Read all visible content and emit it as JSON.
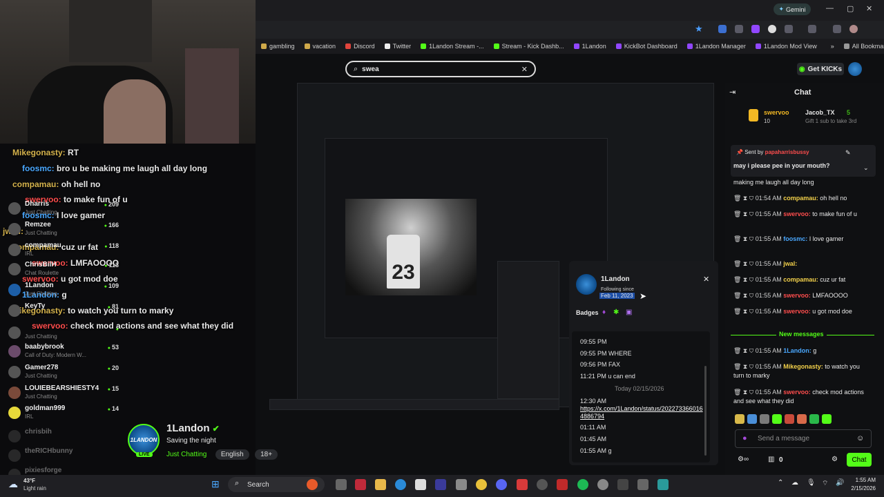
{
  "browser": {
    "gemini_label": "Gemini",
    "bookmarks": [
      "gambling",
      "vacation",
      "Discord",
      "Twitter",
      "1Landon Stream -...",
      "Stream - Kick Dashb...",
      "1Landon",
      "KickBot Dashboard",
      "1Landon Manager",
      "1Landon Mod View"
    ],
    "all_bookmarks": "All Bookmarks"
  },
  "search": {
    "value": "swea"
  },
  "header": {
    "get_kicks": "Get KICKs"
  },
  "stream_overlay": {
    "messages": [
      {
        "user": "Mikegonasty:",
        "text": "RT"
      },
      {
        "user": "foosmc:",
        "text": "bro u be making me laugh all day long"
      },
      {
        "user": "compamau:",
        "text": "oh hell no"
      },
      {
        "user": "swervoo:",
        "text": "to make fun of u"
      },
      {
        "user": "foosmc:",
        "text": "I love gamer"
      },
      {
        "user": "compamau:",
        "text": "cuz ur fat"
      },
      {
        "user": "jwall:",
        "text": ""
      },
      {
        "user": "swervoo:",
        "text": "LMFAOOOO"
      },
      {
        "user": "swervoo:",
        "text": "u got mod doe"
      },
      {
        "user": "1Landon:",
        "text": "g"
      },
      {
        "user": "Mikegonasty:",
        "text": "to watch you turn to marky"
      },
      {
        "user": "swervoo:",
        "text": "check mod actions and see what they did"
      }
    ],
    "viewers": [
      {
        "name": "Dharris",
        "cat": "Just Chatting",
        "count": "209"
      },
      {
        "name": "Remzee",
        "cat": "Just Chatting",
        "count": "166"
      },
      {
        "name": "compamau",
        "cat": "IRL",
        "count": "118"
      },
      {
        "name": "ChrisBilH",
        "cat": "Chat Roulette",
        "count": "113"
      },
      {
        "name": "1Landon",
        "cat": "Just Chatting",
        "count": "109"
      },
      {
        "name": "KeyTy",
        "cat": "",
        "count": "81"
      },
      {
        "name": "",
        "cat": "Just Chatting",
        "count": ""
      },
      {
        "name": "baabybrook",
        "cat": "Call of Duty: Modern W...",
        "count": "53"
      },
      {
        "name": "Gamer278",
        "cat": "Just Chatting",
        "count": "20"
      },
      {
        "name": "LOUIEBEARSHIESTY4",
        "cat": "Just Chatting",
        "count": "15"
      },
      {
        "name": "goldman999",
        "cat": "IRL",
        "count": "14"
      },
      {
        "name": "chrisbih",
        "cat": "",
        "count": ""
      },
      {
        "name": "theRICHbunny",
        "cat": "",
        "count": ""
      },
      {
        "name": "pixiesforge",
        "cat": "",
        "count": ""
      }
    ]
  },
  "stream_info": {
    "avatar_text": "1LANDON",
    "live": "LIVE",
    "name": "1Landon",
    "title": "Saving the night",
    "category": "Just Chatting",
    "language": "English",
    "age": "18+"
  },
  "chat": {
    "title": "Chat",
    "top_gifter": {
      "rank_user": "swervoo",
      "rank_count": "10",
      "second_user": "Jacob_TX",
      "second_count": "5",
      "note": "Gift 1 sub to take 3rd"
    },
    "pinned": {
      "sent_by": "Sent by",
      "sender": "papaharrisbussy",
      "text": "may i please pee in your mouth?"
    },
    "prev_text": "making me laugh all day long",
    "messages": [
      {
        "time": "01:54 AM",
        "user": "compamau:",
        "text": "oh hell no"
      },
      {
        "time": "01:55 AM",
        "user": "swervoo:",
        "text": "to make fun of u"
      },
      {
        "time": "01:55 AM",
        "user": "foosmc:",
        "text": "I love gamer"
      },
      {
        "time": "01:55 AM",
        "user": "jwal:",
        "text": ""
      },
      {
        "time": "01:55 AM",
        "user": "compamau:",
        "text": "cuz ur fat"
      },
      {
        "time": "01:55 AM",
        "user": "swervoo:",
        "text": "LMFAOOOO"
      },
      {
        "time": "01:55 AM",
        "user": "swervoo:",
        "text": "u got mod doe"
      }
    ],
    "new_messages": "New messages",
    "new": [
      {
        "time": "01:55 AM",
        "user": "1Landon:",
        "text": "g"
      },
      {
        "time": "01:55 AM",
        "user": "Mikegonasty:",
        "text": "to watch you turn to marky"
      },
      {
        "time": "01:55 AM",
        "user": "swervoo:",
        "text": "check mod actions and see what they did"
      }
    ],
    "send_placeholder": "Send a message",
    "points": "0",
    "chat_button": "Chat"
  },
  "usercard": {
    "name": "1Landon",
    "following_since": "Following since",
    "date": "Feb 11, 2023",
    "badges": "Badges",
    "history": [
      {
        "t": "09:55 PM",
        "m": ""
      },
      {
        "t": "09:55 PM",
        "m": "WHERE"
      },
      {
        "t": "09:56 PM",
        "m": "FAX"
      },
      {
        "t": "11:21 PM",
        "m": "u can end"
      }
    ],
    "divider": "Today 02/15/2026",
    "history2": [
      {
        "t": "12:30 AM",
        "m": "https://x.com/1Landon/status/2022733660164886794"
      },
      {
        "t": "01:11 AM",
        "m": ""
      },
      {
        "t": "01:45 AM",
        "m": ""
      },
      {
        "t": "01:55 AM",
        "m": "g"
      }
    ]
  },
  "taskbar": {
    "weather_temp": "43°F",
    "weather_desc": "Light rain",
    "search": "Search",
    "time": "1:55 AM",
    "date": "2/15/2026"
  }
}
